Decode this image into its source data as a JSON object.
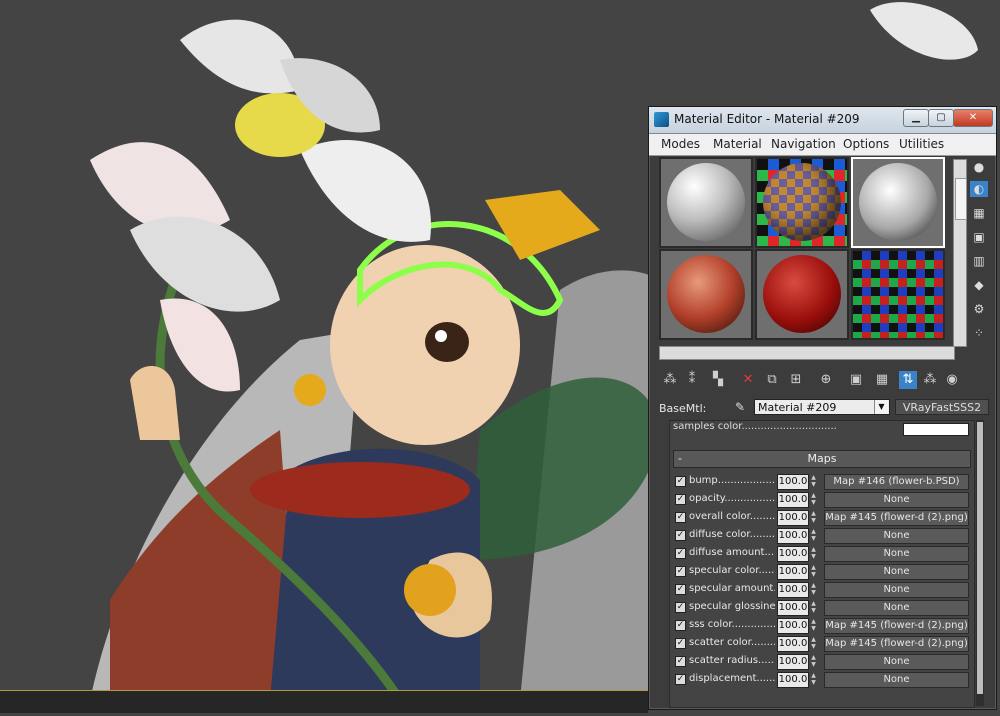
{
  "window": {
    "title": "Material Editor - Material #209",
    "buttons": {
      "minimize": "▁",
      "maximize": "▢",
      "close": "✕"
    }
  },
  "menu": [
    "Modes",
    "Material",
    "Navigation",
    "Options",
    "Utilities"
  ],
  "slots": [
    {
      "name": "slot-1",
      "style": "grey-sphere"
    },
    {
      "name": "slot-2",
      "style": "checker-sphere"
    },
    {
      "name": "slot-3",
      "style": "stone-sphere",
      "selected": true
    },
    {
      "name": "slot-4",
      "style": "red-texture-sphere"
    },
    {
      "name": "slot-5",
      "style": "red-sphere"
    },
    {
      "name": "slot-6",
      "style": "noise-checker"
    }
  ],
  "base": {
    "label": "BaseMtl:",
    "material": "Material #209",
    "type": "VRayFastSSS2"
  },
  "samples_label": "samples color..............................",
  "maps_header": "Maps",
  "maps_collapse": "-",
  "maps": [
    {
      "name": "bump.....................",
      "amount": "100.0",
      "map": "Map #146 (flower-b.PSD)"
    },
    {
      "name": "opacity...................",
      "amount": "100.0",
      "map": "None"
    },
    {
      "name": "overall color........",
      "amount": "100.0",
      "map": "Map #145 (flower-d (2).png)"
    },
    {
      "name": "diffuse color..........",
      "amount": "100.0",
      "map": "None"
    },
    {
      "name": "diffuse amount.....",
      "amount": "100.0",
      "map": "None"
    },
    {
      "name": "specular color.......",
      "amount": "100.0",
      "map": "None"
    },
    {
      "name": "specular amount...",
      "amount": "100.0",
      "map": "None"
    },
    {
      "name": "specular glossiness",
      "amount": "100.0",
      "map": "None"
    },
    {
      "name": "sss color..............",
      "amount": "100.0",
      "map": "Map #145 (flower-d (2).png)"
    },
    {
      "name": "scatter color.........",
      "amount": "100.0",
      "map": "Map #145 (flower-d (2).png)"
    },
    {
      "name": "scatter radius.......",
      "amount": "100.0",
      "map": "None"
    },
    {
      "name": "displacement.......",
      "amount": "100.0",
      "map": "None"
    }
  ],
  "colors": {
    "viewport_bg": "#444444",
    "accent": "#3b83c9"
  }
}
